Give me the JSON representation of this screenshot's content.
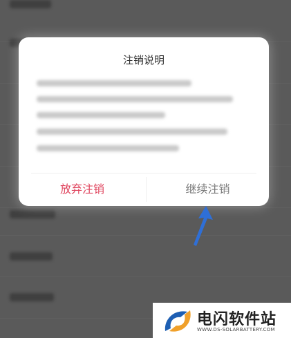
{
  "dialog": {
    "title": "注销说明",
    "abandon_label": "放弃注销",
    "continue_label": "继续注销"
  },
  "watermark": {
    "title": "电闪软件站",
    "subtitle": "WWW.DS-SOLARBATTERY.COM"
  },
  "colors": {
    "abandon": "#e0455e",
    "continue": "#7a7a7a",
    "arrow": "#2f6fd6"
  }
}
